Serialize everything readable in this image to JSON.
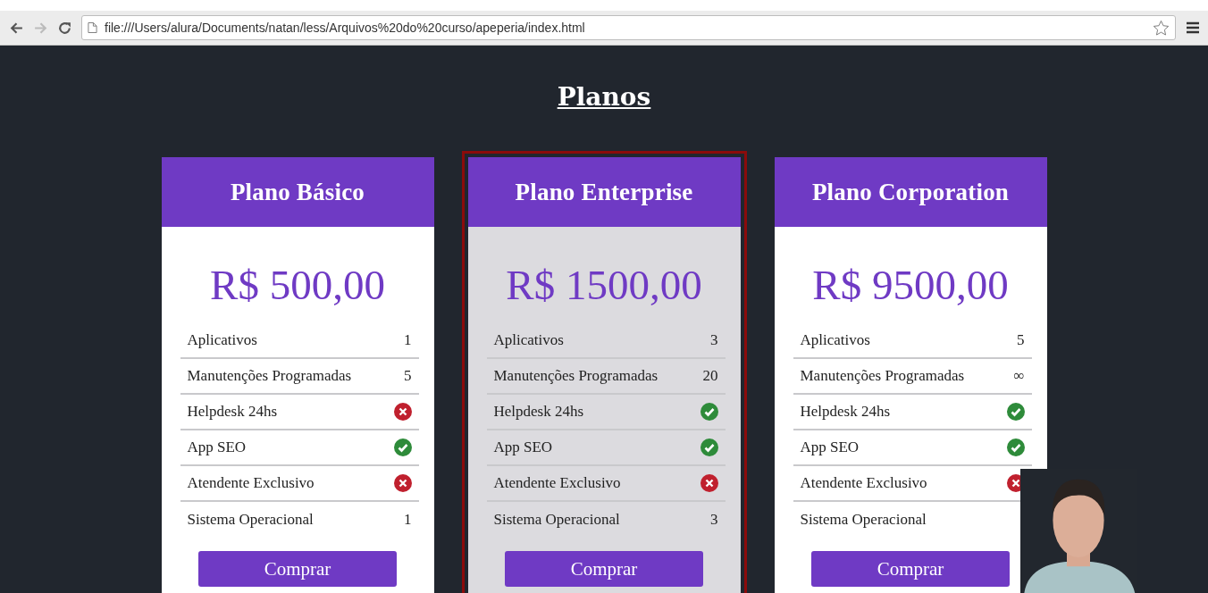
{
  "browser": {
    "url": "file:///Users/alura/Documents/natan/less/Arquivos%20do%20curso/apeperia/index.html"
  },
  "page": {
    "title": "Planos"
  },
  "plans": [
    {
      "name": "Plano Básico",
      "price": "R$ 500,00",
      "selected": false,
      "button": "Comprar",
      "features": [
        {
          "label": "Aplicativos",
          "kind": "text",
          "value": "1"
        },
        {
          "label": "Manutenções Programadas",
          "kind": "text",
          "value": "5"
        },
        {
          "label": "Helpdesk 24hs",
          "kind": "no"
        },
        {
          "label": "App SEO",
          "kind": "yes"
        },
        {
          "label": "Atendente Exclusivo",
          "kind": "no"
        },
        {
          "label": "Sistema Operacional",
          "kind": "text",
          "value": "1"
        }
      ]
    },
    {
      "name": "Plano Enterprise",
      "price": "R$ 1500,00",
      "selected": true,
      "button": "Comprar",
      "features": [
        {
          "label": "Aplicativos",
          "kind": "text",
          "value": "3"
        },
        {
          "label": "Manutenções Programadas",
          "kind": "text",
          "value": "20"
        },
        {
          "label": "Helpdesk 24hs",
          "kind": "yes"
        },
        {
          "label": "App SEO",
          "kind": "yes"
        },
        {
          "label": "Atendente Exclusivo",
          "kind": "no"
        },
        {
          "label": "Sistema Operacional",
          "kind": "text",
          "value": "3"
        }
      ]
    },
    {
      "name": "Plano Corporation",
      "price": "R$ 9500,00",
      "selected": false,
      "button": "Comprar",
      "features": [
        {
          "label": "Aplicativos",
          "kind": "text",
          "value": "5"
        },
        {
          "label": "Manutenções Programadas",
          "kind": "text",
          "value": "∞"
        },
        {
          "label": "Helpdesk 24hs",
          "kind": "yes"
        },
        {
          "label": "App SEO",
          "kind": "yes"
        },
        {
          "label": "Atendente Exclusivo",
          "kind": "no"
        },
        {
          "label": "Sistema Operacional",
          "kind": "hidden"
        }
      ]
    }
  ]
}
